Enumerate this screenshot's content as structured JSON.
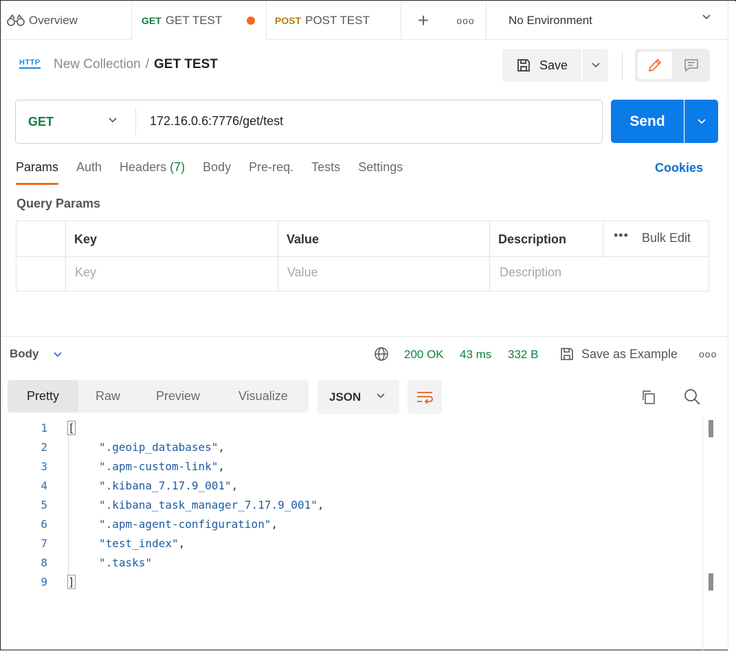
{
  "tabs": {
    "overview": "Overview",
    "active": {
      "method": "GET",
      "name": "GET TEST"
    },
    "second": {
      "method": "POST",
      "name": "POST TEST"
    },
    "plus": "+",
    "more": "ooo"
  },
  "environment": {
    "label": "No Environment"
  },
  "header": {
    "icon_text": "HTTP",
    "collection": "New Collection",
    "separator": "/",
    "request_name": "GET TEST",
    "save_label": "Save"
  },
  "request": {
    "method": "GET",
    "url": "172.16.0.6:7776/get/test",
    "send_label": "Send"
  },
  "request_tabs": {
    "params": "Params",
    "auth": "Auth",
    "headers": "Headers",
    "headers_count": "(7)",
    "body": "Body",
    "prereq": "Pre-req.",
    "tests": "Tests",
    "settings": "Settings",
    "cookies": "Cookies"
  },
  "query_params": {
    "title": "Query Params",
    "headers": {
      "key": "Key",
      "value": "Value",
      "description": "Description",
      "bulk_edit": "Bulk Edit",
      "more": "•••"
    },
    "placeholders": {
      "key": "Key",
      "value": "Value",
      "description": "Description"
    }
  },
  "response": {
    "title": "Body",
    "status": "200 OK",
    "time": "43 ms",
    "size": "332 B",
    "save_example": "Save as Example",
    "more": "ooo",
    "view_tabs": [
      "Pretty",
      "Raw",
      "Preview",
      "Visualize"
    ],
    "format": "JSON",
    "lines": [
      {
        "n": "1",
        "text": "["
      },
      {
        "n": "2",
        "text": "\".geoip_databases\"",
        "comma": ","
      },
      {
        "n": "3",
        "text": "\".apm-custom-link\"",
        "comma": ","
      },
      {
        "n": "4",
        "text": "\".kibana_7.17.9_001\"",
        "comma": ","
      },
      {
        "n": "5",
        "text": "\".kibana_task_manager_7.17.9_001\"",
        "comma": ","
      },
      {
        "n": "6",
        "text": "\".apm-agent-configuration\"",
        "comma": ","
      },
      {
        "n": "7",
        "text": "\"test_index\"",
        "comma": ","
      },
      {
        "n": "8",
        "text": "\".tasks\"",
        "comma": ""
      },
      {
        "n": "9",
        "text": "]"
      }
    ]
  },
  "colors": {
    "accent": "#f26b21",
    "send": "#0b7bea",
    "get": "#0b7f3b",
    "post": "#b47d00",
    "link": "#0b6fd0"
  }
}
